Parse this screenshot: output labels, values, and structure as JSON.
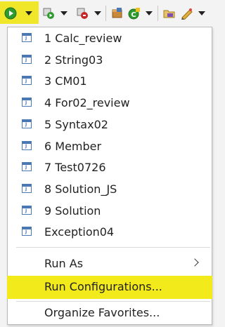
{
  "toolbar": {
    "buttons": [
      {
        "name": "run-icon",
        "color": "#2d9b2d"
      },
      {
        "name": "debug-icon"
      },
      {
        "name": "external-tools-icon"
      },
      {
        "name": "new-project-icon"
      },
      {
        "name": "open-type-icon"
      }
    ],
    "highlight_color": "#f0e62a"
  },
  "menu": {
    "history": [
      {
        "label": "1 Calc_review"
      },
      {
        "label": "2 String03"
      },
      {
        "label": "3 CM01"
      },
      {
        "label": "4 For02_review"
      },
      {
        "label": "5 Syntax02"
      },
      {
        "label": "6 Member"
      },
      {
        "label": "7 Test0726"
      },
      {
        "label": "8 Solution_JS"
      },
      {
        "label": "9 Solution"
      },
      {
        "label": "Exception04"
      }
    ],
    "icon_letter": "J",
    "run_as": "Run As",
    "run_configurations": "Run Configurations...",
    "organize_favorites": "Organize Favorites...",
    "highlight_color": "#f3ea1b"
  }
}
